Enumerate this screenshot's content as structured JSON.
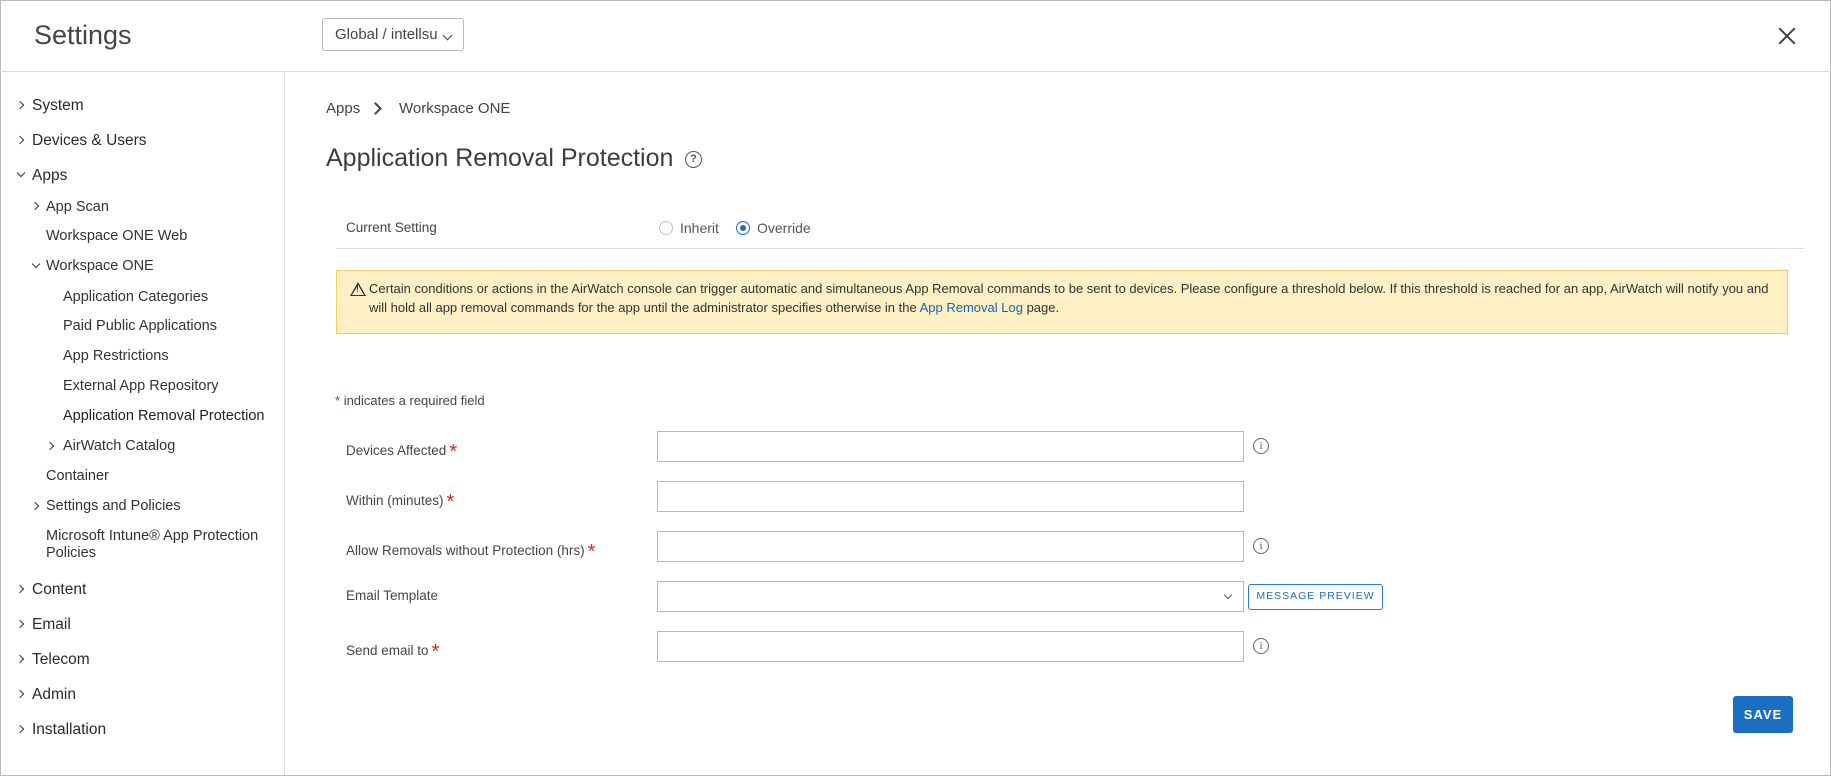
{
  "header": {
    "title": "Settings",
    "org_selector": "Global / intellsu"
  },
  "sidebar": {
    "system": "System",
    "devices_users": "Devices & Users",
    "apps": "Apps",
    "app_scan": "App Scan",
    "workspace_one_web": "Workspace ONE Web",
    "workspace_one": "Workspace ONE",
    "application_categories": "Application Categories",
    "paid_public_applications": "Paid Public Applications",
    "app_restrictions": "App Restrictions",
    "external_app_repository": "External App Repository",
    "application_removal_protection": "Application Removal Protection",
    "airwatch_catalog": "AirWatch Catalog",
    "container": "Container",
    "settings_and_policies": "Settings and Policies",
    "intune_line1": "Microsoft Intune® App Protection",
    "intune_line2": "Policies",
    "content": "Content",
    "email": "Email",
    "telecom": "Telecom",
    "admin": "Admin",
    "installation": "Installation"
  },
  "breadcrumb": {
    "first": "Apps",
    "second": "Workspace ONE"
  },
  "page": {
    "title": "Application Removal Protection"
  },
  "current_setting": {
    "label": "Current Setting",
    "inherit": "Inherit",
    "override": "Override",
    "selected": "Override"
  },
  "warning": {
    "text_before": "Certain conditions or actions in the AirWatch console can trigger automatic and simultaneous App Removal commands to be sent to devices. Please configure a threshold below. If this threshold is reached for an app, AirWatch will notify you and will hold all app removal commands for the app until the administrator specifies otherwise in the ",
    "link": "App Removal Log",
    "text_after": " page."
  },
  "form": {
    "required_note": "indicates a required field",
    "required_star": "*",
    "devices_affected": {
      "label": "Devices Affected",
      "value": ""
    },
    "within_minutes": {
      "label": "Within (minutes)",
      "value": ""
    },
    "allow_removals": {
      "label": "Allow Removals without Protection (hrs)",
      "value": ""
    },
    "email_template": {
      "label": "Email Template",
      "value": ""
    },
    "send_email_to": {
      "label": "Send email to",
      "value": ""
    }
  },
  "buttons": {
    "message_preview": "MESSAGE PREVIEW",
    "save": "SAVE"
  },
  "colors": {
    "accent": "#1b6fc2",
    "required": "#d9281e",
    "warning_bg": "#fdf0c4",
    "warning_border": "#f2cd63"
  },
  "icons": {
    "close": "close-icon",
    "help": "help-circle-icon",
    "info": "info-circle-icon",
    "warning": "warning-triangle-icon"
  }
}
